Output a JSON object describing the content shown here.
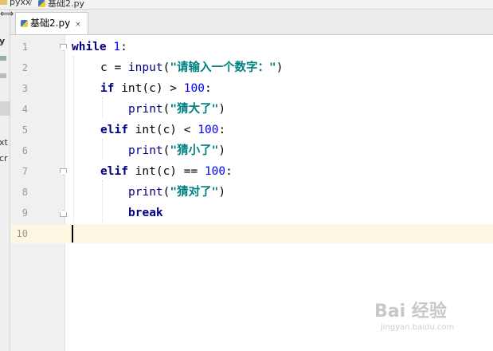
{
  "breadcrumb": {
    "project": "pyxx",
    "separator": "/",
    "file": "基础2.py"
  },
  "sidebar": {
    "fragments": [
      "y",
      "xt",
      "cr"
    ]
  },
  "resize_glyph": "⟺",
  "tab": {
    "label": "基础2.py",
    "close": "×"
  },
  "editor": {
    "line_numbers": [
      "1",
      "2",
      "3",
      "4",
      "5",
      "6",
      "7",
      "8",
      "9",
      "10"
    ],
    "code": {
      "l1": {
        "kw": "while",
        "num": "1",
        "rest": ":"
      },
      "l2": {
        "pre": "c = ",
        "fn": "input",
        "open": "(",
        "str": "\"请输入一个数字：\"",
        "close": ")"
      },
      "l3": {
        "kw": "if",
        "mid": " int(c) > ",
        "num": "100",
        "rest": ":"
      },
      "l4": {
        "fn": "print",
        "open": "(",
        "str": "\"猜大了\"",
        "close": ")"
      },
      "l5": {
        "kw": "elif",
        "mid": " int(c) < ",
        "num": "100",
        "rest": ":"
      },
      "l6": {
        "fn": "print",
        "open": "(",
        "str": "\"猜小了\"",
        "close": ")"
      },
      "l7": {
        "kw": "elif",
        "mid": " int(c) == ",
        "num": "100",
        "rest": ":"
      },
      "l8": {
        "fn": "print",
        "open": "(",
        "str": "\"猜对了\"",
        "close": ")"
      },
      "l9": {
        "kw": "break"
      }
    }
  },
  "watermark": {
    "brand": "Bai 经验",
    "url": "jingyan.baidu.com"
  },
  "colors": {
    "keyword": "#000080",
    "number": "#0000ff",
    "string": "#008080",
    "current_line": "#fcf7e0"
  }
}
